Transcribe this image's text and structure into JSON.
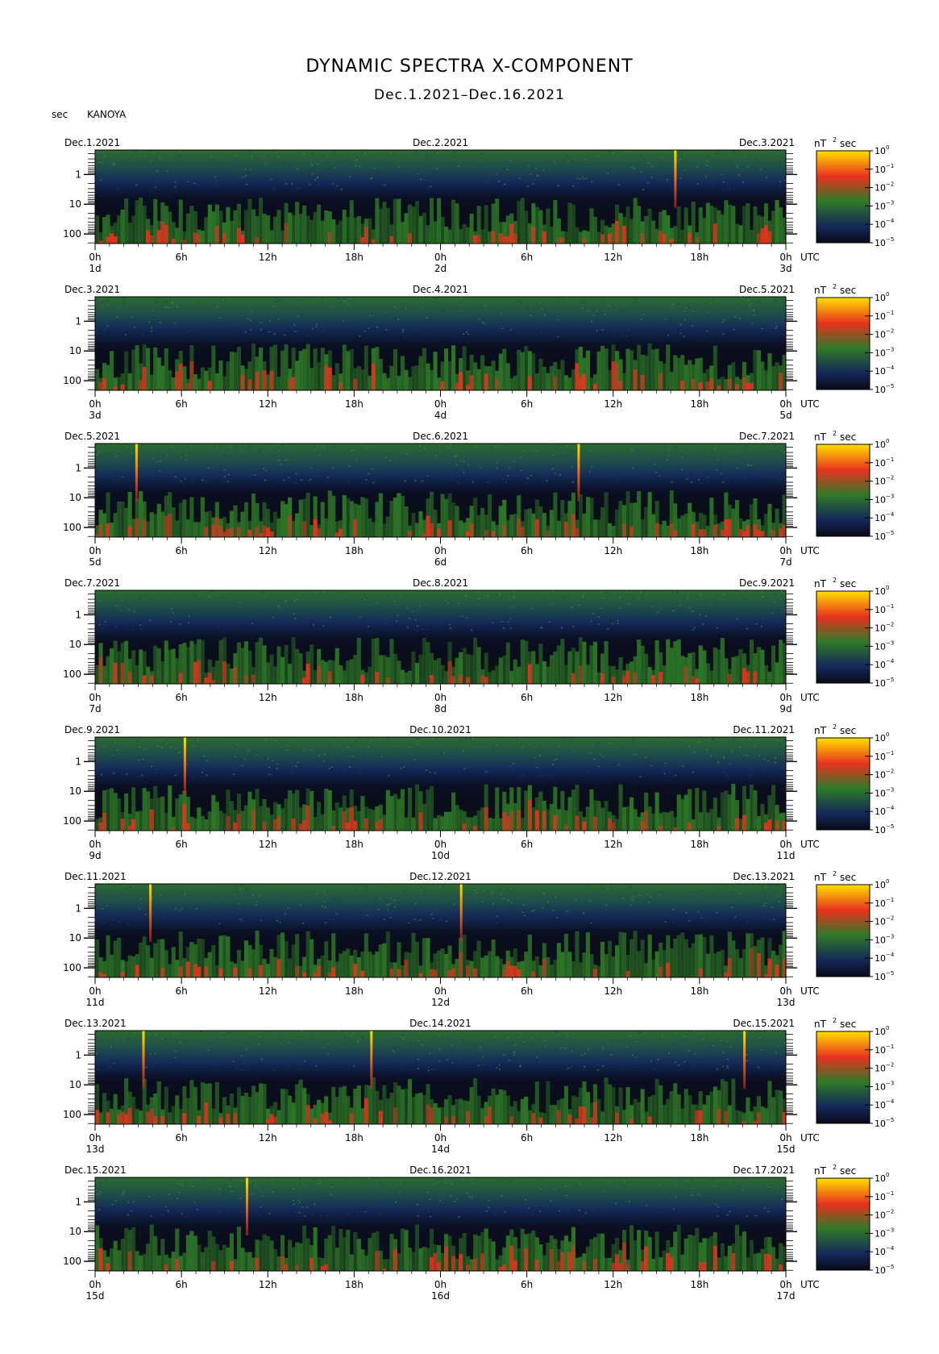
{
  "title": "DYNAMIC SPECTRA X-COMPONENT",
  "subtitle": "Dec.1.2021–Dec.16.2021",
  "station": "KANOYA",
  "yunit": "sec",
  "cbar_unit": "nT",
  "cbar_unit_exp": "2",
  "cbar_unit_sec": "sec",
  "utc_label": "UTC",
  "colors": {
    "low": "#0a0a18",
    "navy": "#14285a",
    "green": "#2f7a28",
    "red": "#e8321e",
    "yellow": "#ffe000"
  },
  "chart_data": {
    "type": "heatmap",
    "y_scale": "log",
    "y_ticks": [
      "1",
      "10",
      "100"
    ],
    "x_ticks": [
      "0h",
      "6h",
      "12h",
      "18h",
      "0h",
      "6h",
      "12h",
      "18h",
      "0h"
    ],
    "colorbar_ticks": [
      "10",
      "10",
      "10",
      "10",
      "10",
      "10"
    ],
    "colorbar_exps": [
      "0",
      "−1",
      "−2",
      "−3",
      "−4",
      "−5"
    ],
    "panels": [
      {
        "start": "Dec.1.2021",
        "mid": "Dec.2.2021",
        "end": "Dec.3.2021",
        "day_labels": [
          "1d",
          "2d",
          "3d"
        ],
        "spikes": [
          0.84
        ]
      },
      {
        "start": "Dec.3.2021",
        "mid": "Dec.4.2021",
        "end": "Dec.5.2021",
        "day_labels": [
          "3d",
          "4d",
          "5d"
        ],
        "spikes": []
      },
      {
        "start": "Dec.5.2021",
        "mid": "Dec.6.2021",
        "end": "Dec.7.2021",
        "day_labels": [
          "5d",
          "6d",
          "7d"
        ],
        "spikes": [
          0.06,
          0.7
        ]
      },
      {
        "start": "Dec.7.2021",
        "mid": "Dec.8.2021",
        "end": "Dec.9.2021",
        "day_labels": [
          "7d",
          "8d",
          "9d"
        ],
        "spikes": []
      },
      {
        "start": "Dec.9.2021",
        "mid": "Dec.10.2021",
        "end": "Dec.11.2021",
        "day_labels": [
          "9d",
          "10d",
          "11d"
        ],
        "spikes": [
          0.13
        ]
      },
      {
        "start": "Dec.11.2021",
        "mid": "Dec.12.2021",
        "end": "Dec.13.2021",
        "day_labels": [
          "11d",
          "12d",
          "13d"
        ],
        "spikes": [
          0.08,
          0.53
        ]
      },
      {
        "start": "Dec.13.2021",
        "mid": "Dec.14.2021",
        "end": "Dec.15.2021",
        "day_labels": [
          "13d",
          "14d",
          "15d"
        ],
        "spikes": [
          0.07,
          0.4,
          0.94
        ]
      },
      {
        "start": "Dec.15.2021",
        "mid": "Dec.16.2021",
        "end": "Dec.17.2021",
        "day_labels": [
          "15d",
          "16d",
          "17d"
        ],
        "spikes": [
          0.22
        ]
      }
    ]
  }
}
